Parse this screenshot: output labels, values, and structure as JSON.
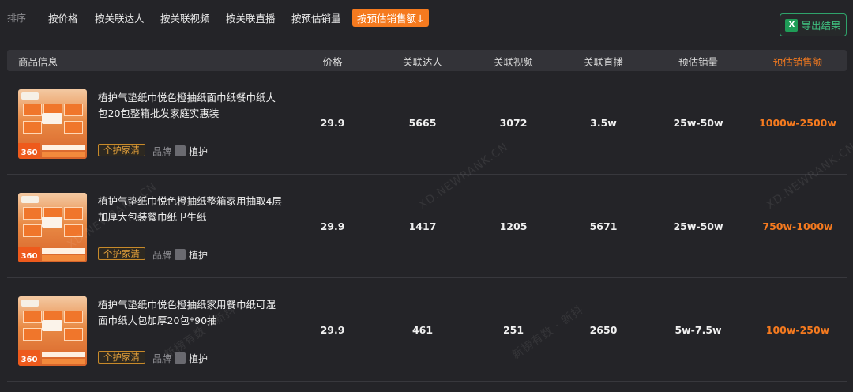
{
  "sort": {
    "label": "排序",
    "options": [
      "按价格",
      "按关联达人",
      "按关联视频",
      "按关联直播",
      "按预估销量",
      "按预估销售额↓"
    ]
  },
  "export": {
    "label": "导出结果",
    "icon": "excel-icon",
    "icon_text": "X"
  },
  "columns": [
    "商品信息",
    "价格",
    "关联达人",
    "关联视频",
    "关联直播",
    "预估销量",
    "预估销售额"
  ],
  "rows": [
    {
      "title": "植护气垫纸巾悦色橙抽纸面巾纸餐巾纸大包20包整箱批发家庭实惠装",
      "tag": "个护家清",
      "brand_label": "品牌",
      "brand": "植护",
      "badge": "360",
      "price": "29.9",
      "influencers": "5665",
      "videos": "3072",
      "live": "3.5w",
      "sales": "25w-50w",
      "revenue": "1000w-2500w"
    },
    {
      "title": "植护气垫纸巾悦色橙抽纸整箱家用抽取4层加厚大包装餐巾纸卫生纸",
      "tag": "个护家清",
      "brand_label": "品牌",
      "brand": "植护",
      "badge": "360",
      "price": "29.9",
      "influencers": "1417",
      "videos": "1205",
      "live": "5671",
      "sales": "25w-50w",
      "revenue": "750w-1000w"
    },
    {
      "title": "植护气垫纸巾悦色橙抽纸家用餐巾纸可湿面巾纸大包加厚20包*90抽",
      "tag": "个护家清",
      "brand_label": "品牌",
      "brand": "植护",
      "badge": "360",
      "price": "29.9",
      "influencers": "461",
      "videos": "251",
      "live": "2650",
      "sales": "5w-7.5w",
      "revenue": "100w-250w"
    }
  ],
  "watermarks": [
    "XD.NEWRANK.CN",
    "XD.NEWRANK.CN",
    "XD.NEWRANK.CN",
    "新榜有数 · 新抖",
    "新榜有数 · 新抖"
  ],
  "colors": {
    "accent": "#f57a1f",
    "export": "#3fbf7f",
    "background": "#242428"
  }
}
